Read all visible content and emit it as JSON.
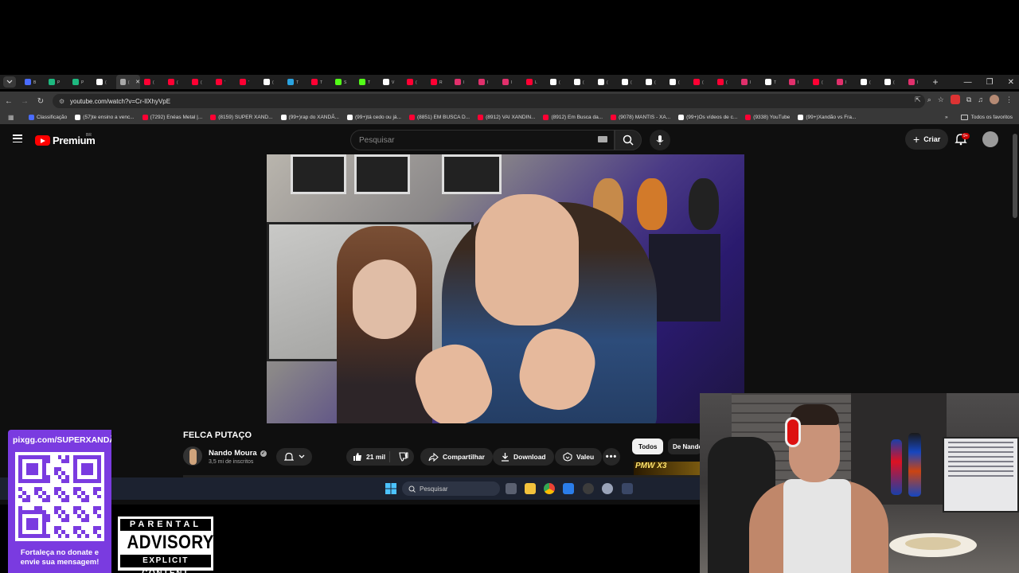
{
  "browser": {
    "tabs": [
      {
        "favicon_color": "#4a6cff",
        "active": false,
        "letter": "B"
      },
      {
        "favicon_color": "#1eb980",
        "active": false,
        "letter": "P"
      },
      {
        "favicon_color": "#1eb980",
        "active": false,
        "letter": "P"
      },
      {
        "favicon_color": "#ffffff",
        "active": false,
        "letter": "("
      },
      {
        "favicon_color": "#aaaaaa",
        "active": true,
        "letter": "("
      },
      {
        "favicon_color": "#ff0033",
        "active": false,
        "letter": "("
      },
      {
        "favicon_color": "#ff0033",
        "active": false,
        "letter": "("
      },
      {
        "favicon_color": "#ff0033",
        "active": false,
        "letter": "("
      },
      {
        "favicon_color": "#ff0033",
        "active": false,
        "letter": "'"
      },
      {
        "favicon_color": "#ff0033",
        "active": false,
        "letter": "'"
      },
      {
        "favicon_color": "#ffffff",
        "active": false,
        "letter": "("
      },
      {
        "favicon_color": "#2aa3e0",
        "active": false,
        "letter": "T"
      },
      {
        "favicon_color": "#ff0033",
        "active": false,
        "letter": "T"
      },
      {
        "favicon_color": "#53fc18",
        "active": false,
        "letter": "S"
      },
      {
        "favicon_color": "#53fc18",
        "active": false,
        "letter": "T"
      },
      {
        "favicon_color": "#ffffff",
        "active": false,
        "letter": "V"
      },
      {
        "favicon_color": "#ff0033",
        "active": false,
        "letter": "("
      },
      {
        "favicon_color": "#ff0033",
        "active": false,
        "letter": "R"
      },
      {
        "favicon_color": "#e1306c",
        "active": false,
        "letter": "I"
      },
      {
        "favicon_color": "#e1306c",
        "active": false,
        "letter": "I"
      },
      {
        "favicon_color": "#e1306c",
        "active": false,
        "letter": "I"
      },
      {
        "favicon_color": "#ff0033",
        "active": false,
        "letter": "L"
      },
      {
        "favicon_color": "#ffffff",
        "active": false,
        "letter": "("
      },
      {
        "favicon_color": "#ffffff",
        "active": false,
        "letter": "("
      },
      {
        "favicon_color": "#ffffff",
        "active": false,
        "letter": "("
      },
      {
        "favicon_color": "#ffffff",
        "active": false,
        "letter": "("
      },
      {
        "favicon_color": "#ffffff",
        "active": false,
        "letter": "("
      },
      {
        "favicon_color": "#ffffff",
        "active": false,
        "letter": "("
      },
      {
        "favicon_color": "#ff0033",
        "active": false,
        "letter": "("
      },
      {
        "favicon_color": "#ff0033",
        "active": false,
        "letter": "("
      },
      {
        "favicon_color": "#e1306c",
        "active": false,
        "letter": "I"
      },
      {
        "favicon_color": "#ffffff",
        "active": false,
        "letter": "T"
      },
      {
        "favicon_color": "#e1306c",
        "active": false,
        "letter": "I"
      },
      {
        "favicon_color": "#ff0033",
        "active": false,
        "letter": "("
      },
      {
        "favicon_color": "#e1306c",
        "active": false,
        "letter": "I"
      },
      {
        "favicon_color": "#ffffff",
        "active": false,
        "letter": "("
      },
      {
        "favicon_color": "#ffffff",
        "active": false,
        "letter": "("
      },
      {
        "favicon_color": "#e1306c",
        "active": false,
        "letter": "I"
      }
    ],
    "url": "youtube.com/watch?v=Cr-IlXhyVpE",
    "bookmarks": [
      {
        "label": "Classificação",
        "color": "#4a6cff"
      },
      {
        "label": "(57)te ensino a venc...",
        "color": "#ffffff"
      },
      {
        "label": "(7292) Enéas Metal |...",
        "color": "#ff0033"
      },
      {
        "label": "(8159) SUPER XAND...",
        "color": "#ff0033"
      },
      {
        "label": "(99+)rap do XANDÃ...",
        "color": "#ffffff"
      },
      {
        "label": "(99+)tá cedo ou já...",
        "color": "#ffffff"
      },
      {
        "label": "(8851) EM BUSCA D...",
        "color": "#ff0033"
      },
      {
        "label": "(8912) VAI XANDIN...",
        "color": "#ff0033"
      },
      {
        "label": "(8912) Em Busca da...",
        "color": "#ff0033"
      },
      {
        "label": "(9078) MANTIS - XA...",
        "color": "#ff0033"
      },
      {
        "label": "(99+)Os vídeos de c...",
        "color": "#ffffff"
      },
      {
        "label": "(9338) YouTube",
        "color": "#ff0033"
      },
      {
        "label": "(99+)Xandão vs Fra...",
        "color": "#ffffff"
      }
    ],
    "bookmarks_more": "»",
    "all_bookmarks": "Todos os favoritos"
  },
  "youtube": {
    "brand": "Premium",
    "country": "BR",
    "search_placeholder": "Pesquisar",
    "create_label": "Criar",
    "notification_badge": "9+",
    "video": {
      "title": "FELCA PUTAÇO",
      "channel": "Nando Moura",
      "subscribers": "3,5 mi de inscritos",
      "likes": "21 mil",
      "share_label": "Compartilhar",
      "download_label": "Download",
      "thanks_label": "Valeu"
    },
    "chips": [
      "Todos",
      "De Nando"
    ],
    "rec_thumb_text": "PMW X3"
  },
  "taskbar": {
    "search_placeholder": "Pesquisar"
  },
  "overlay": {
    "qr_url": "pixgg.com/SUPERXANDÃO",
    "qr_caption_1": "Fortaleça no donate e",
    "qr_caption_2": "envie sua mensagem!",
    "qr_color": "#7a3be0",
    "pa_top": "PARENTAL",
    "pa_mid": "ADVISORY",
    "pa_bot": "EXPLICIT CONTENT"
  },
  "colors": {
    "yt_red": "#ff0000",
    "chrome_dark": "#1f1f1f",
    "yt_bg": "#0f0f0f"
  }
}
